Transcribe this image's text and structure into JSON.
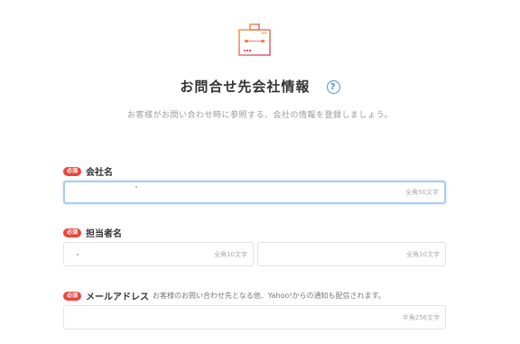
{
  "header": {
    "title": "お問合せ先会社情報",
    "help_icon": "?",
    "subtitle": "お客様がお問い合わせ時に参照する、会社の情報を登録しましょう。"
  },
  "fields": {
    "company": {
      "required": "必須",
      "label": "会社名",
      "counter": "全角50文字"
    },
    "contact_person": {
      "required": "必須",
      "label": "担当者名",
      "counter_last": "全角10文字",
      "counter_first": "全角10文字"
    },
    "email": {
      "required": "必須",
      "label": "メールアドレス",
      "hint": "お客様のお問い合わせ先となる他、Yahoo!からの通知も配信されます。",
      "counter": "半角256文字"
    }
  },
  "colors": {
    "required_badge": "#e8473c",
    "focus_border": "#a9ccf2",
    "help_icon": "#4a90d9"
  }
}
